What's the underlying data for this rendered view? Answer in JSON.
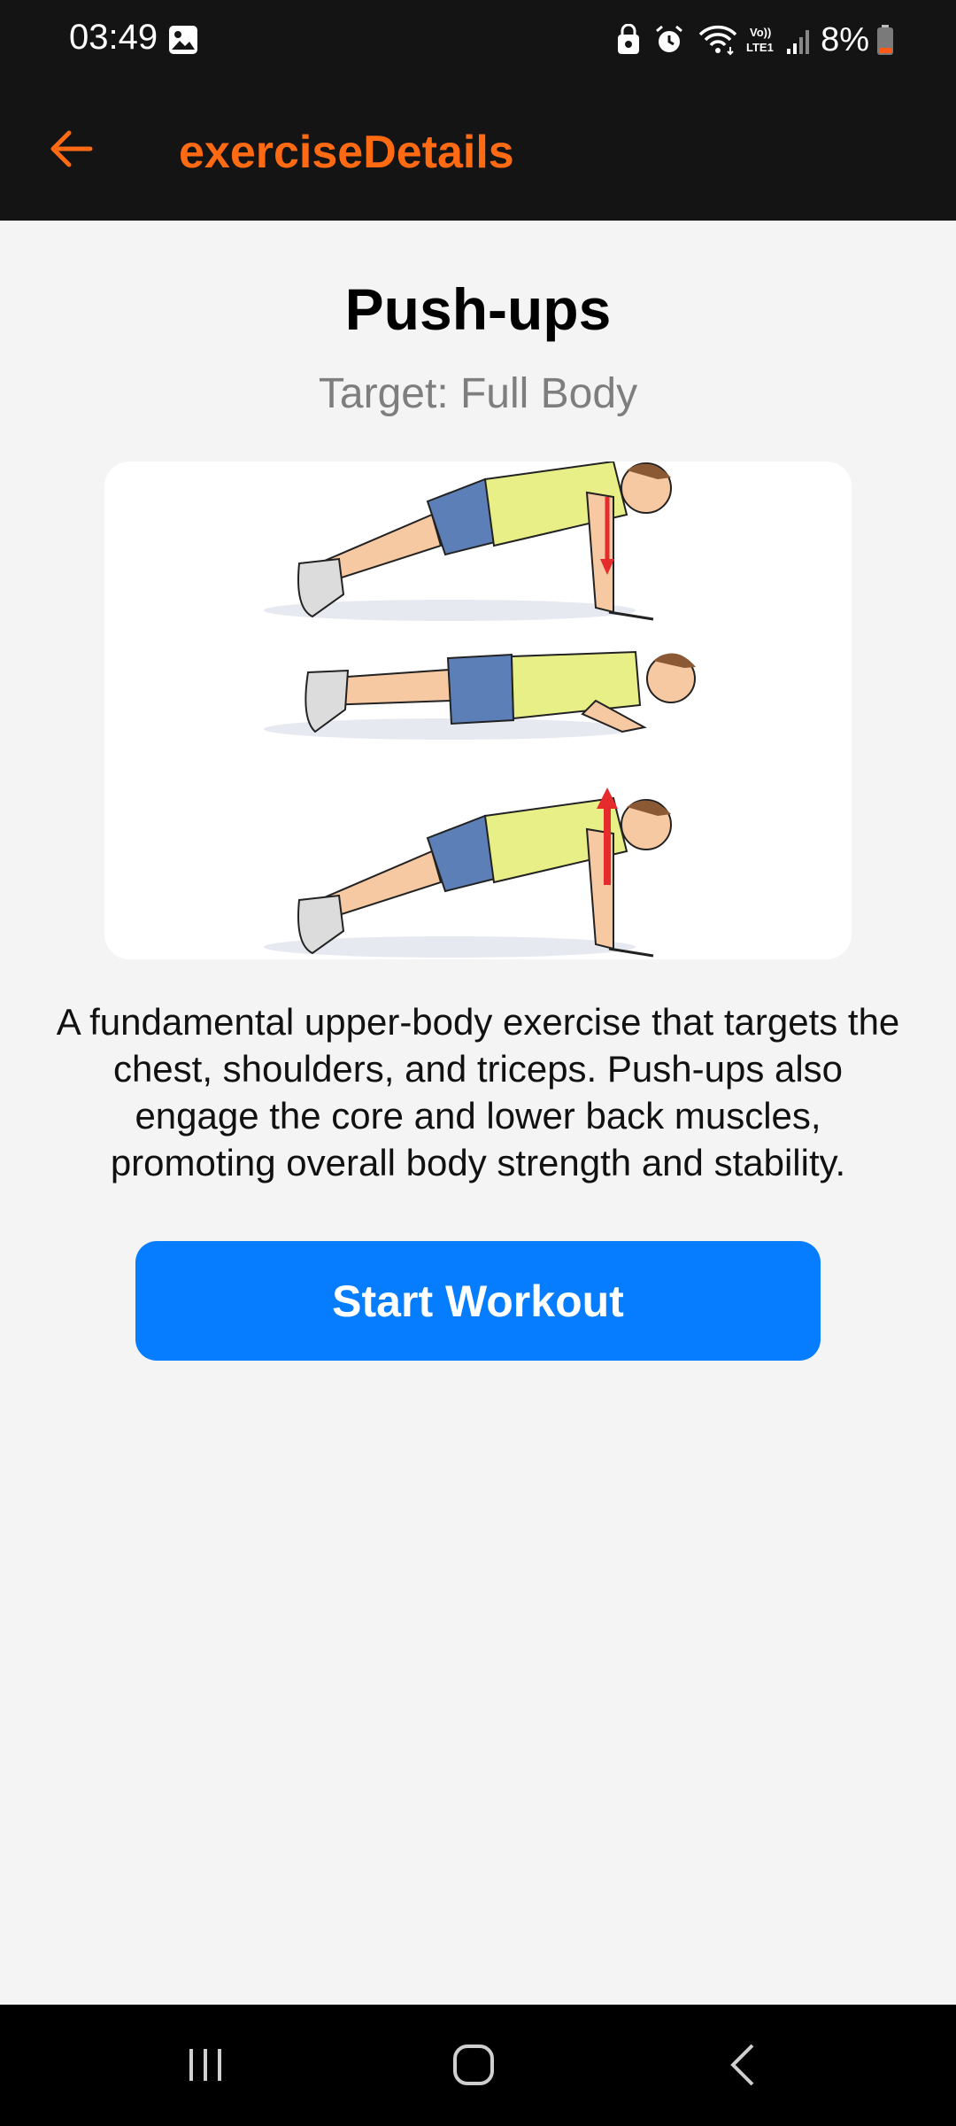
{
  "status_bar": {
    "time": "03:49",
    "battery_percent": "8%",
    "network_label": "VoLTE1",
    "icons": [
      "gallery-icon",
      "vpn-lock-icon",
      "alarm-icon",
      "wifi-icon",
      "lte-icon",
      "signal-icon",
      "battery-icon"
    ]
  },
  "app_bar": {
    "title": "exerciseDetails",
    "back_icon": "arrow-left-icon",
    "accent_color": "#ff6a13"
  },
  "exercise": {
    "name": "Push-ups",
    "target": "Target: Full Body",
    "image_alt": "push-up illustration",
    "description": "A fundamental upper-body exercise that targets the chest, shoulders, and triceps. Push-ups also engage the core and lower back muscles, promoting overall body strength and stability."
  },
  "actions": {
    "start_workout_label": "Start Workout",
    "button_color": "#067cff"
  },
  "nav_bar": {
    "icons": [
      "recent-apps-icon",
      "home-icon",
      "back-icon"
    ]
  }
}
